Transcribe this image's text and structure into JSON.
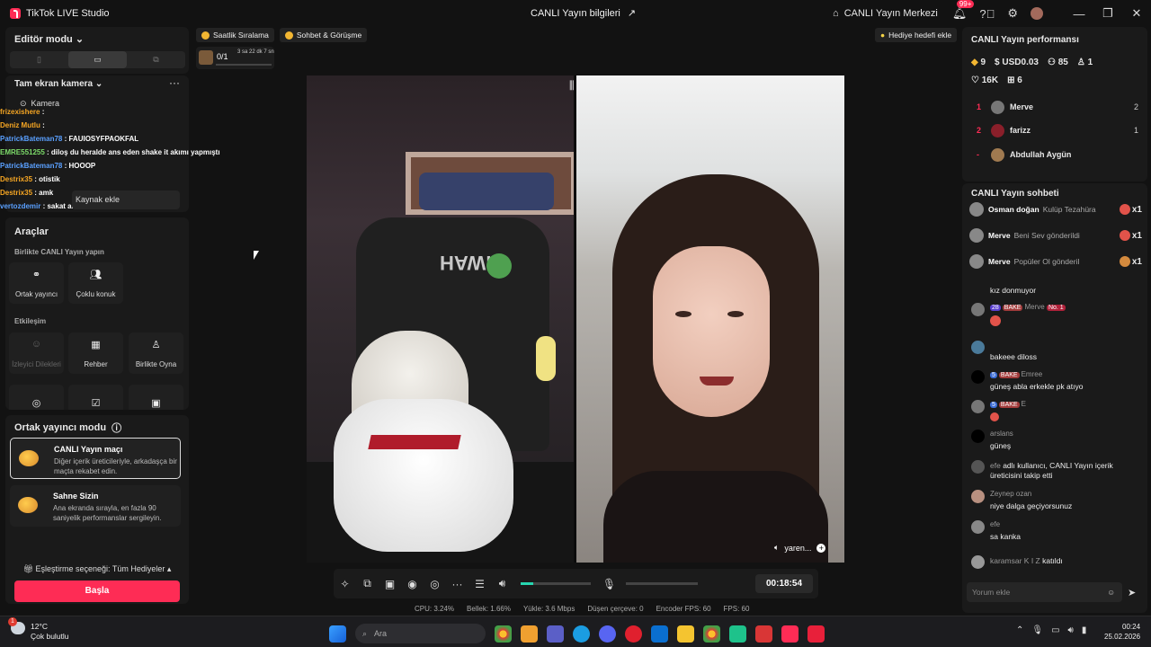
{
  "app": {
    "title": "TikTok LIVE Studio",
    "center_title": "CANLI Yayın bilgileri",
    "center_link": "CANLI Yayın Merkezi",
    "notif_badge": "99+"
  },
  "editor": {
    "title": "Editör modu"
  },
  "camera": {
    "title": "Tam ekran kamera",
    "item": "Kamera",
    "add_source": "Kaynak ekle"
  },
  "overlay_chat": [
    {
      "user": "frizexishere",
      "text": ""
    },
    {
      "user": "Deniz Mutlu",
      "text": ""
    },
    {
      "user": "PatrickBateman78",
      "text": "FAUIOSYFPAOKFAL"
    },
    {
      "user": "EMRE551255",
      "text": "diloş du heralde ans eden shake it akımı yapmıştı"
    },
    {
      "user": "PatrickBateman78",
      "text": "HOOOP"
    },
    {
      "user": "Destrix35",
      "text": "otistik"
    },
    {
      "user": "Destrix35",
      "text": "amk"
    },
    {
      "user": "vertozdemir",
      "text": "sakat amk"
    }
  ],
  "tools": {
    "title": "Araçlar",
    "section1": "Birlikte CANLI Yayın yapın",
    "btn_cohost": "Ortak yayıncı",
    "btn_multi": "Çoklu konuk",
    "section2": "Etkileşim",
    "btn_requests": "İzleyici Dilekleri",
    "btn_guide": "Rehber",
    "btn_play": "Birlikte Oyna"
  },
  "cohost_mode": {
    "title": "Ortak yayıncı modu",
    "card1_title": "CANLI Yayın maçı",
    "card1_desc": "Diğer içerik üreticileriyle, arkadaşça bir maçta rekabet edin.",
    "card2_title": "Sahne Sizin",
    "card2_desc": "Ana ekranda sırayla, en fazla 90 saniyelik performanslar sergileyin.",
    "gift_option": "Eşleştirme seçeneği: Tüm Hediyeler",
    "start": "Başla"
  },
  "chips": {
    "hourly": "Saatlik Sıralama",
    "chat_meet": "Sohbet & Görüşme",
    "gift_goal": "Hediye hedefi ekle"
  },
  "progress": {
    "count": "0/1",
    "time": "3 sa 22 dk 7 sn"
  },
  "video": {
    "guest_name": "yaren..."
  },
  "controls": {
    "timer": "00:18:54",
    "volume_level": 0.18
  },
  "stats": {
    "cpu": "CPU: 3.24%",
    "mem": "Bellek: 1.66%",
    "upload": "Yükle: 3.6 Mbps",
    "dropped": "Düşen çerçeve: 0",
    "enc_fps": "Encoder FPS: 60",
    "fps": "FPS: 60"
  },
  "performance": {
    "title": "CANLI Yayın performansı",
    "diamonds": "9",
    "usd": "USD0.03",
    "viewers": "85",
    "followers": "1",
    "likes": "16K",
    "gifts": "6",
    "ranking": [
      {
        "rank": "1",
        "name": "Merve",
        "score": "2"
      },
      {
        "rank": "2",
        "name": "farizz",
        "score": "1"
      },
      {
        "rank": "-",
        "name": "Abdullah Aygün",
        "score": ""
      }
    ]
  },
  "live_chat": {
    "title": "CANLI Yayın sohbeti",
    "gifts": [
      {
        "user": "Osman doğan",
        "text": "Kulüp Tezahüra",
        "count": "x1"
      },
      {
        "user": "Merve",
        "text": "Beni Sev gönderildi",
        "count": "x1"
      },
      {
        "user": "Merve",
        "text": "Popüler Ol gönderil",
        "count": "x1"
      }
    ],
    "top_msg": "kız donmuyor",
    "messages": [
      {
        "badge": "28",
        "badge2": "BAKE",
        "name": "Merve",
        "badge3": "No. 1",
        "msg": ""
      },
      {
        "name": "",
        "msg": "bakeee diloss"
      },
      {
        "badge": "5",
        "badge2": "BAKE",
        "name": "Emree",
        "msg": "güneş abla erkekle pk atıyo"
      },
      {
        "badge": "5",
        "badge2": "BAKE",
        "name": "E",
        "msg": ""
      },
      {
        "name": "arslans",
        "msg": "güneş"
      },
      {
        "name": "efe",
        "msg": "adlı kullanıcı, CANLI Yayın içerik üreticisini takip etti"
      },
      {
        "name": "Zeynep ozan",
        "msg": "niye dalga geçiyorsunuz"
      },
      {
        "name": "efe",
        "msg": "sa kanka"
      },
      {
        "name": "karamsar K I Z",
        "msg": "katıldı"
      }
    ],
    "input_placeholder": "Yorum ekle"
  },
  "taskbar": {
    "temp": "12°C",
    "weather": "Çok bulutlu",
    "search": "Ara",
    "time": "00:24",
    "date": "25.02.2026",
    "weather_badge": "1"
  }
}
